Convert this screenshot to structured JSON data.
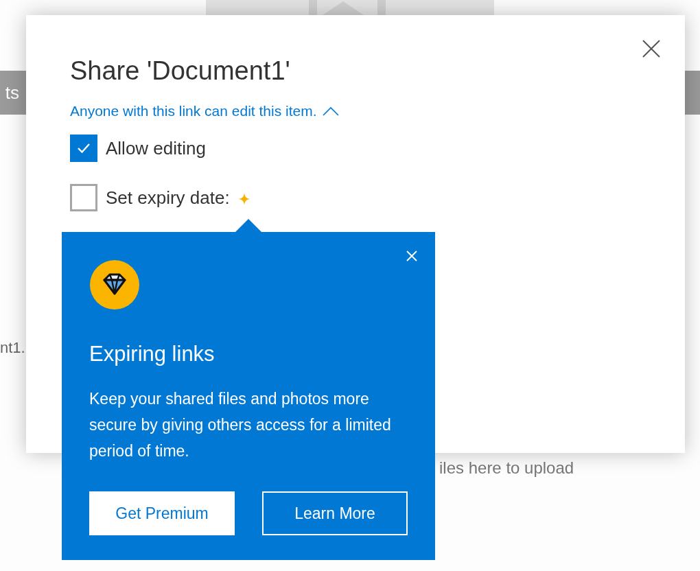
{
  "background": {
    "tab_label": "ts",
    "file_name": "nt1.",
    "upload_hint": "iles here to upload"
  },
  "dialog": {
    "title": "Share 'Document1'",
    "link_scope": "Anyone with this link can edit this item.",
    "expanded": true,
    "options": [
      {
        "label": "Allow editing",
        "checked": true,
        "premium": false
      },
      {
        "label": "Set expiry date:",
        "checked": false,
        "premium": true
      }
    ]
  },
  "callout": {
    "title": "Expiring links",
    "body": "Keep your shared files and photos more secure by giving others access for a limited period of time.",
    "buttons": [
      {
        "label": "Get Premium",
        "kind": "primary"
      },
      {
        "label": "Learn More",
        "kind": "outline"
      }
    ]
  }
}
